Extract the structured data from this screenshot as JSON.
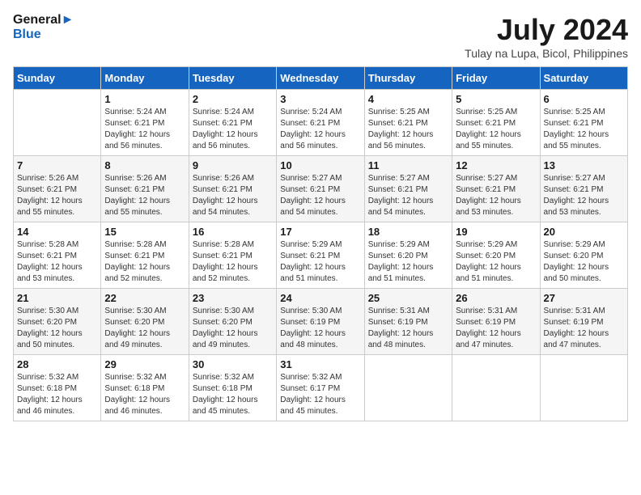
{
  "logo": {
    "line1": "General",
    "line2": "Blue"
  },
  "title": "July 2024",
  "subtitle": "Tulay na Lupa, Bicol, Philippines",
  "calendar": {
    "headers": [
      "Sunday",
      "Monday",
      "Tuesday",
      "Wednesday",
      "Thursday",
      "Friday",
      "Saturday"
    ],
    "weeks": [
      [
        {
          "day": "",
          "info": ""
        },
        {
          "day": "1",
          "info": "Sunrise: 5:24 AM\nSunset: 6:21 PM\nDaylight: 12 hours\nand 56 minutes."
        },
        {
          "day": "2",
          "info": "Sunrise: 5:24 AM\nSunset: 6:21 PM\nDaylight: 12 hours\nand 56 minutes."
        },
        {
          "day": "3",
          "info": "Sunrise: 5:24 AM\nSunset: 6:21 PM\nDaylight: 12 hours\nand 56 minutes."
        },
        {
          "day": "4",
          "info": "Sunrise: 5:25 AM\nSunset: 6:21 PM\nDaylight: 12 hours\nand 56 minutes."
        },
        {
          "day": "5",
          "info": "Sunrise: 5:25 AM\nSunset: 6:21 PM\nDaylight: 12 hours\nand 55 minutes."
        },
        {
          "day": "6",
          "info": "Sunrise: 5:25 AM\nSunset: 6:21 PM\nDaylight: 12 hours\nand 55 minutes."
        }
      ],
      [
        {
          "day": "7",
          "info": ""
        },
        {
          "day": "8",
          "info": "Sunrise: 5:26 AM\nSunset: 6:21 PM\nDaylight: 12 hours\nand 55 minutes."
        },
        {
          "day": "9",
          "info": "Sunrise: 5:26 AM\nSunset: 6:21 PM\nDaylight: 12 hours\nand 54 minutes."
        },
        {
          "day": "10",
          "info": "Sunrise: 5:27 AM\nSunset: 6:21 PM\nDaylight: 12 hours\nand 54 minutes."
        },
        {
          "day": "11",
          "info": "Sunrise: 5:27 AM\nSunset: 6:21 PM\nDaylight: 12 hours\nand 54 minutes."
        },
        {
          "day": "12",
          "info": "Sunrise: 5:27 AM\nSunset: 6:21 PM\nDaylight: 12 hours\nand 53 minutes."
        },
        {
          "day": "13",
          "info": "Sunrise: 5:27 AM\nSunset: 6:21 PM\nDaylight: 12 hours\nand 53 minutes."
        }
      ],
      [
        {
          "day": "14",
          "info": ""
        },
        {
          "day": "15",
          "info": "Sunrise: 5:28 AM\nSunset: 6:21 PM\nDaylight: 12 hours\nand 52 minutes."
        },
        {
          "day": "16",
          "info": "Sunrise: 5:28 AM\nSunset: 6:21 PM\nDaylight: 12 hours\nand 52 minutes."
        },
        {
          "day": "17",
          "info": "Sunrise: 5:29 AM\nSunset: 6:21 PM\nDaylight: 12 hours\nand 51 minutes."
        },
        {
          "day": "18",
          "info": "Sunrise: 5:29 AM\nSunset: 6:20 PM\nDaylight: 12 hours\nand 51 minutes."
        },
        {
          "day": "19",
          "info": "Sunrise: 5:29 AM\nSunset: 6:20 PM\nDaylight: 12 hours\nand 51 minutes."
        },
        {
          "day": "20",
          "info": "Sunrise: 5:29 AM\nSunset: 6:20 PM\nDaylight: 12 hours\nand 50 minutes."
        }
      ],
      [
        {
          "day": "21",
          "info": ""
        },
        {
          "day": "22",
          "info": "Sunrise: 5:30 AM\nSunset: 6:20 PM\nDaylight: 12 hours\nand 49 minutes."
        },
        {
          "day": "23",
          "info": "Sunrise: 5:30 AM\nSunset: 6:20 PM\nDaylight: 12 hours\nand 49 minutes."
        },
        {
          "day": "24",
          "info": "Sunrise: 5:30 AM\nSunset: 6:19 PM\nDaylight: 12 hours\nand 48 minutes."
        },
        {
          "day": "25",
          "info": "Sunrise: 5:31 AM\nSunset: 6:19 PM\nDaylight: 12 hours\nand 48 minutes."
        },
        {
          "day": "26",
          "info": "Sunrise: 5:31 AM\nSunset: 6:19 PM\nDaylight: 12 hours\nand 47 minutes."
        },
        {
          "day": "27",
          "info": "Sunrise: 5:31 AM\nSunset: 6:19 PM\nDaylight: 12 hours\nand 47 minutes."
        }
      ],
      [
        {
          "day": "28",
          "info": "Sunrise: 5:32 AM\nSunset: 6:18 PM\nDaylight: 12 hours\nand 46 minutes."
        },
        {
          "day": "29",
          "info": "Sunrise: 5:32 AM\nSunset: 6:18 PM\nDaylight: 12 hours\nand 46 minutes."
        },
        {
          "day": "30",
          "info": "Sunrise: 5:32 AM\nSunset: 6:18 PM\nDaylight: 12 hours\nand 45 minutes."
        },
        {
          "day": "31",
          "info": "Sunrise: 5:32 AM\nSunset: 6:17 PM\nDaylight: 12 hours\nand 45 minutes."
        },
        {
          "day": "",
          "info": ""
        },
        {
          "day": "",
          "info": ""
        },
        {
          "day": "",
          "info": ""
        }
      ]
    ],
    "week1_sunday_info": "Sunrise: 5:26 AM\nSunset: 6:21 PM\nDaylight: 12 hours\nand 55 minutes.",
    "week3_sunday_info": "Sunrise: 5:28 AM\nSunset: 6:21 PM\nDaylight: 12 hours\nand 53 minutes.",
    "week4_sunday_info": "Sunrise: 5:30 AM\nSunset: 6:20 PM\nDaylight: 12 hours\nand 50 minutes."
  }
}
